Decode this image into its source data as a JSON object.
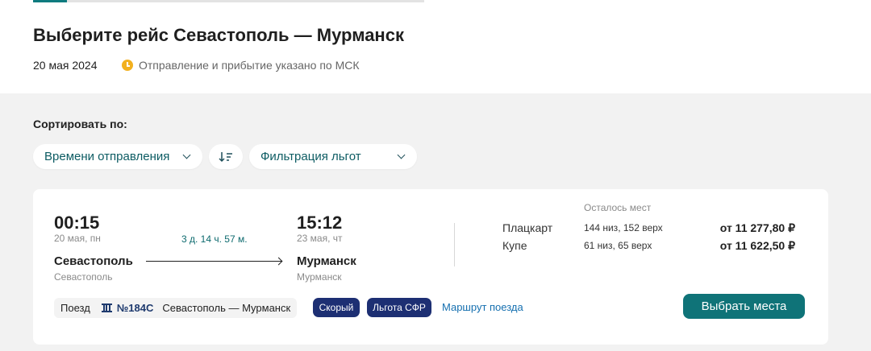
{
  "header": {
    "title": "Выберите рейс Севастополь — Мурманск",
    "date": "20 мая 2024",
    "timezone_note": "Отправление и прибытие указано по МСК"
  },
  "sort": {
    "label": "Сортировать по:",
    "selected": "Времени отправления",
    "filter": "Фильтрация льгот",
    "order_icon": "sort-order-icon"
  },
  "trip": {
    "departure_time": "00:15",
    "departure_date": "20 мая, пн",
    "duration": "3 д. 14 ч. 57 м.",
    "arrival_time": "15:12",
    "arrival_date": "23 мая, чт",
    "from_city": "Севастополь",
    "from_station": "Севастополь",
    "to_city": "Мурманск",
    "to_station": "Мурманск",
    "seats_header": "Осталось мест",
    "classes": [
      {
        "name": "Плацкарт",
        "seats": "144 низ, 152 верх",
        "price": "от 11 277,80 ₽"
      },
      {
        "name": "Купе",
        "seats": "61 низ, 65 верх",
        "price": "от 11 622,50 ₽"
      }
    ],
    "train_label": "Поезд",
    "train_number": "№184С",
    "train_route": "Севастополь — Мурманск",
    "badges": [
      "Скорый",
      "Льгота СФР"
    ],
    "route_link": "Маршрут поезда",
    "choose_button": "Выбрать места"
  },
  "colors": {
    "accent": "#0f7378",
    "badge": "#1d2f73",
    "link": "#1670b0",
    "clock": "#f2b01e"
  }
}
